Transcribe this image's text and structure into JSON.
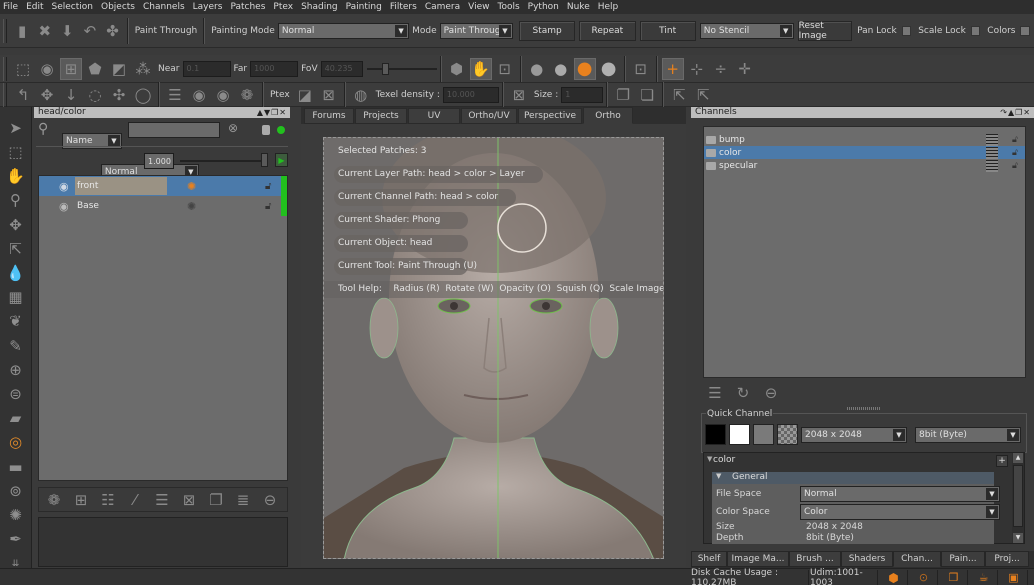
{
  "menu": [
    "File",
    "Edit",
    "Selection",
    "Objects",
    "Channels",
    "Layers",
    "Patches",
    "Ptex",
    "Shading",
    "Painting",
    "Filters",
    "Camera",
    "View",
    "Tools",
    "Python",
    "Nuke",
    "Help"
  ],
  "toolbar1": {
    "tool_name": "Paint Through",
    "painting_mode_label": "Painting Mode",
    "painting_mode_value": "Normal",
    "mode_label": "Mode",
    "mode_value": "Paint Through",
    "stamp": "Stamp",
    "repeat": "Repeat",
    "tint": "Tint",
    "stencil_value": "No Stencil",
    "reset_image": "Reset Image",
    "pan_lock": "Pan Lock",
    "scale_lock": "Scale Lock",
    "colors": "Colors"
  },
  "toolbar2": {
    "near_label": "Near",
    "near_value": "0.1",
    "far_label": "Far",
    "far_value": "1000",
    "fov_label": "FoV",
    "fov_value": "40.235"
  },
  "toolbar3": {
    "ptex_label": "Ptex",
    "texel_label": "Texel density :",
    "texel_value": "10.000",
    "size_label": "Size :",
    "size_value": "1"
  },
  "layers_panel": {
    "title": "head/color",
    "filter_value": "Name",
    "blend_mode": "Normal",
    "opacity": "1.000",
    "layers": [
      {
        "name": "front",
        "selected": true
      },
      {
        "name": "Base",
        "selected": false
      }
    ]
  },
  "viewport": {
    "tabs": [
      "Forums",
      "Projects",
      "UV",
      "Ortho/UV",
      "Perspective",
      "Ortho"
    ],
    "active_tab": "Ortho",
    "hud": [
      "Selected Patches: 3",
      "Current Layer Path: head > color > Layer",
      "Current Channel Path: head > color",
      "Current Shader: Phong",
      "Current Object: head",
      "Current Tool: Paint Through (U)"
    ],
    "tool_help": "Tool Help:    Radius (R)  Rotate (W)  Opacity (O)  Squish (Q)  Scale Image (Ctrl+Shift)  Mov"
  },
  "channels_panel": {
    "title": "Channels",
    "channels": [
      {
        "name": "bump",
        "selected": false
      },
      {
        "name": "color",
        "selected": true
      },
      {
        "name": "specular",
        "selected": false
      }
    ],
    "quick_channel_label": "Quick Channel",
    "quick_size": "2048 x 2048",
    "quick_depth": "8bit  (Byte)",
    "props_header": "color",
    "general_label": "General",
    "file_space_label": "File Space",
    "file_space_value": "Normal",
    "color_space_label": "Color Space",
    "color_space_value": "Color",
    "size_label": "Size",
    "size_value": "2048 x 2048",
    "depth_label": "Depth",
    "depth_value": "8bit  (Byte)"
  },
  "bottom_tabs": [
    "Shelf",
    "Image Ma...",
    "Brush ...",
    "Shaders",
    "Chan...",
    "Pain...",
    "Proj..."
  ],
  "active_bottom_tab": "Chan...",
  "status": {
    "disk_cache": "Disk Cache Usage : 110.27MB",
    "udim": "Udim:1001-1003"
  },
  "colors": {
    "accent_orange": "#e8811e",
    "selection_blue": "#4b7aaa",
    "layer_green": "#22c01e"
  }
}
